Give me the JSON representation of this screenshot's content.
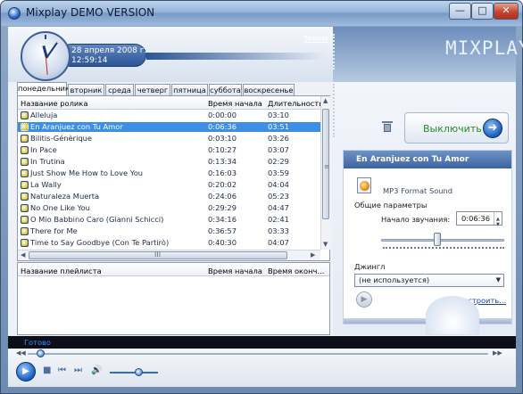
{
  "window": {
    "title": "Mixplay DEMO VERSION",
    "min_label": "—",
    "max_label": "□",
    "close_label": "✕"
  },
  "header": {
    "date": "28 апреля 2008 г.",
    "time": "12:59:14",
    "menu_link": "Меню",
    "logo": "MIXPLAY"
  },
  "tabs": [
    "понедельник",
    "вторник",
    "среда",
    "четверг",
    "пятница",
    "суббота",
    "воскресенье"
  ],
  "active_tab": "понедельник",
  "tracklist": {
    "columns": [
      "Название ролика",
      "Время начала",
      "Длительность"
    ],
    "rows": [
      {
        "name": "Alleluja",
        "start": "0:00:00",
        "duration": "03:10"
      },
      {
        "name": "En Aranjuez con Tu Amor",
        "start": "0:06:36",
        "duration": "03:51",
        "selected": true
      },
      {
        "name": "Bilitis-Génèrique",
        "start": "0:03:10",
        "duration": "03:26"
      },
      {
        "name": "In Pace",
        "start": "0:10:27",
        "duration": "03:07"
      },
      {
        "name": "In Trutina",
        "start": "0:13:34",
        "duration": "02:29"
      },
      {
        "name": "Just Show Me How to Love You",
        "start": "0:16:03",
        "duration": "03:59"
      },
      {
        "name": "La Wally",
        "start": "0:20:02",
        "duration": "04:04"
      },
      {
        "name": "Naturaleza Muerta",
        "start": "0:24:06",
        "duration": "05:23"
      },
      {
        "name": "No One Like You",
        "start": "0:29:29",
        "duration": "04:47"
      },
      {
        "name": "O Mio Babbino Caro (Gianni Schicci)",
        "start": "0:34:16",
        "duration": "02:41"
      },
      {
        "name": "There for Me",
        "start": "0:36:57",
        "duration": "03:33"
      },
      {
        "name": "Time to Say Goodbye (Con Te Partirò)",
        "start": "0:40:30",
        "duration": "04:07"
      }
    ],
    "grip": "≡",
    "hscroll_grip": "III"
  },
  "playlists": {
    "columns": [
      "Название плейлиста",
      "Время начала",
      "Время оконч..."
    ]
  },
  "right_panel": {
    "off_button": "Выключить",
    "track_title": "En Aranjuez con Tu Amor",
    "format": "MP3 Format Sound",
    "common_params": "Общие параметры",
    "start_label": "Начало звучания:",
    "start_value": "0:06:36",
    "start_slider_fraction": 0.45,
    "jingle_label": "Джингл",
    "jingle_value": "(не используется)",
    "setup_link": "Настроить..."
  },
  "status": {
    "text": "Готово"
  },
  "transport": {
    "seek_fraction": 0.02,
    "volume_fraction": 0.55
  },
  "colors": {
    "selection": "#3d8ee6",
    "status_text": "#3b8cff",
    "off_label": "#2a8a2a",
    "link": "#1b3fae"
  }
}
